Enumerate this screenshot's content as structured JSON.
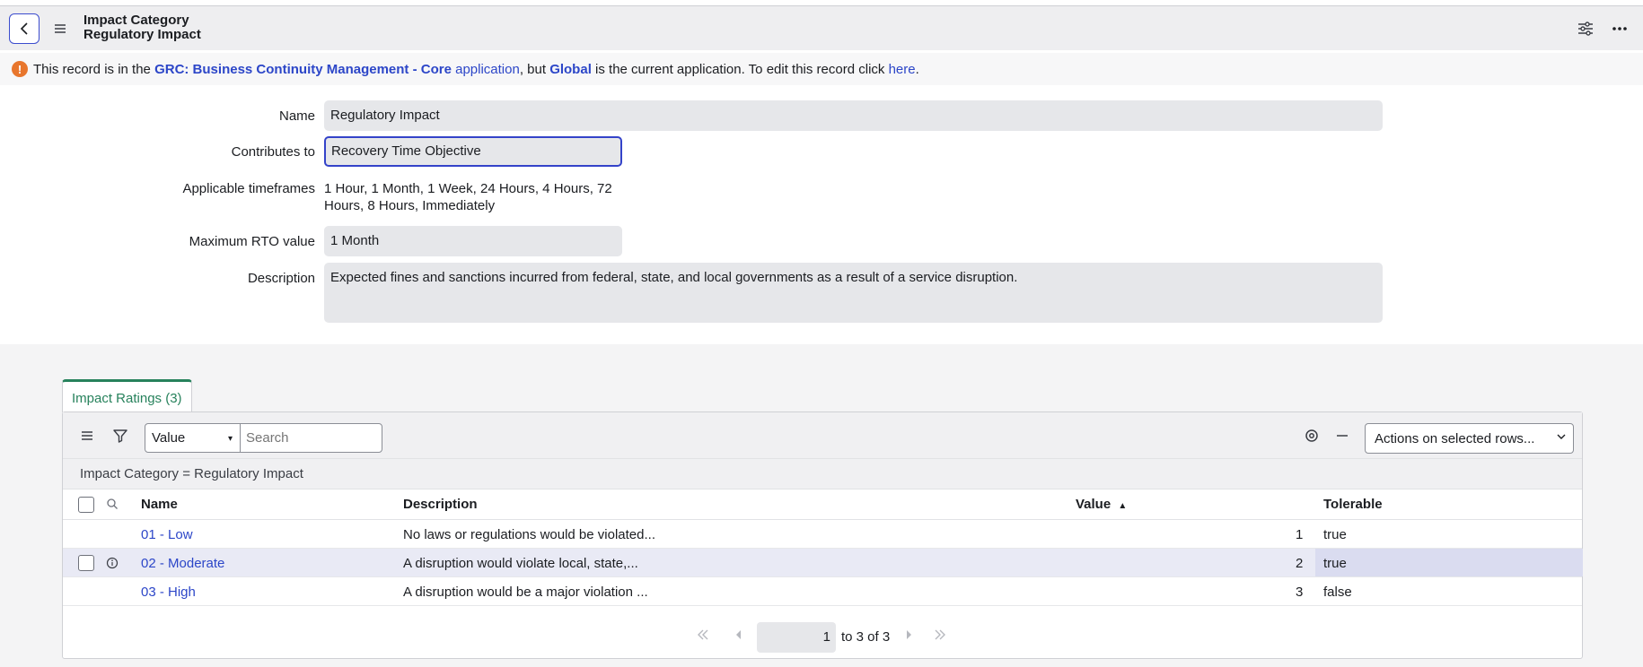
{
  "header": {
    "title_line1": "Impact Category",
    "title_line2": "Regulatory Impact",
    "icons": [
      "chevron-left-icon",
      "hamburger-icon",
      "sliders-icon",
      "more-icon"
    ]
  },
  "notice": {
    "prefix": "This record is in the ",
    "app_name": "GRC: Business Continuity Management - Core",
    "app_link": "application",
    "middle": ", but ",
    "current_app": "Global",
    "suffix": " is the current application. To edit this record click ",
    "here_link": "here",
    "end": "."
  },
  "form": {
    "name_label": "Name",
    "name_value": "Regulatory Impact",
    "contributes_label": "Contributes to",
    "contributes_value": "Recovery Time Objective",
    "timeframes_label": "Applicable timeframes",
    "timeframes_line1": "1 Hour, 1 Month, 1 Week, 24 Hours, 4 Hours, 72",
    "timeframes_line2": "Hours, 8 Hours, Immediately",
    "max_rto_label": "Maximum RTO value",
    "max_rto_value": "1 Month",
    "description_label": "Description",
    "description_value": "Expected fines and sanctions incurred from federal, state, and local governments as a result of a service disruption."
  },
  "related_list": {
    "tab_label": "Impact Ratings (3)",
    "search_field": "Value",
    "search_placeholder": "Search",
    "actions_label": "Actions on selected rows...",
    "breadcrumb": "Impact Category = Regulatory Impact",
    "columns": {
      "name": "Name",
      "description": "Description",
      "value": "Value",
      "tolerable": "Tolerable"
    },
    "rows": [
      {
        "name": "01 - Low",
        "description": "No laws or regulations would be violated...",
        "value": "1",
        "tolerable": "true"
      },
      {
        "name": "02 - Moderate",
        "description": "A disruption would violate local, state,...",
        "value": "2",
        "tolerable": "true"
      },
      {
        "name": "03 - High",
        "description": "A disruption would be a major violation ...",
        "value": "3",
        "tolerable": "false"
      }
    ],
    "pager": {
      "current": "1",
      "range_text": "to 3 of 3"
    }
  },
  "colors": {
    "accent": "#3443c9",
    "link": "#2c46c8",
    "tab_green": "#27825c",
    "warning": "#e8762d"
  }
}
